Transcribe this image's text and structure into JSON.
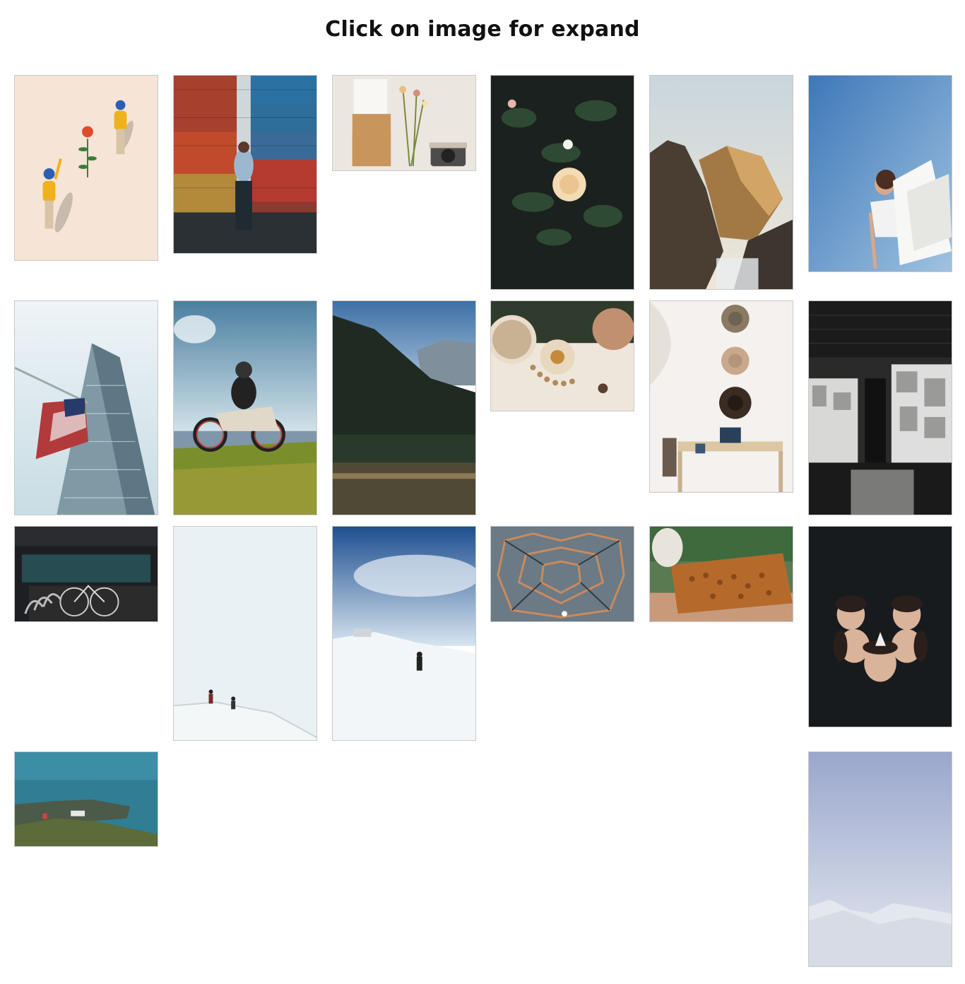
{
  "page": {
    "title": "Click on image for expand"
  },
  "gallery": {
    "images": [
      {
        "subject": "illustration-people-waving-flower"
      },
      {
        "subject": "man-shipping-containers"
      },
      {
        "subject": "envelope-dried-flowers-camera"
      },
      {
        "subject": "white-rose-dark-leaves"
      },
      {
        "subject": "rocks-seaside"
      },
      {
        "subject": "woman-white-fabric-sky"
      },
      {
        "subject": "skyscraper-american-flag"
      },
      {
        "subject": "motorbike-rider-grass"
      },
      {
        "subject": "mountain-lake-forest"
      },
      {
        "subject": "table-beads-vases"
      },
      {
        "subject": "hats-wall-desk-laptop"
      },
      {
        "subject": "black-tiled-storefront"
      },
      {
        "subject": "bicycle-rack-bridge"
      },
      {
        "subject": "hikers-snowy-hill"
      },
      {
        "subject": "hiker-snow-blue-sky"
      },
      {
        "subject": "geometric-structure-aerial"
      },
      {
        "subject": "honeycomb-frame-beekeeper"
      },
      {
        "subject": "friends-circle-selfie"
      },
      {
        "subject": "coast-aerial-sea"
      },
      {
        "subject": "snowy-mountains-pale-sky"
      }
    ]
  }
}
